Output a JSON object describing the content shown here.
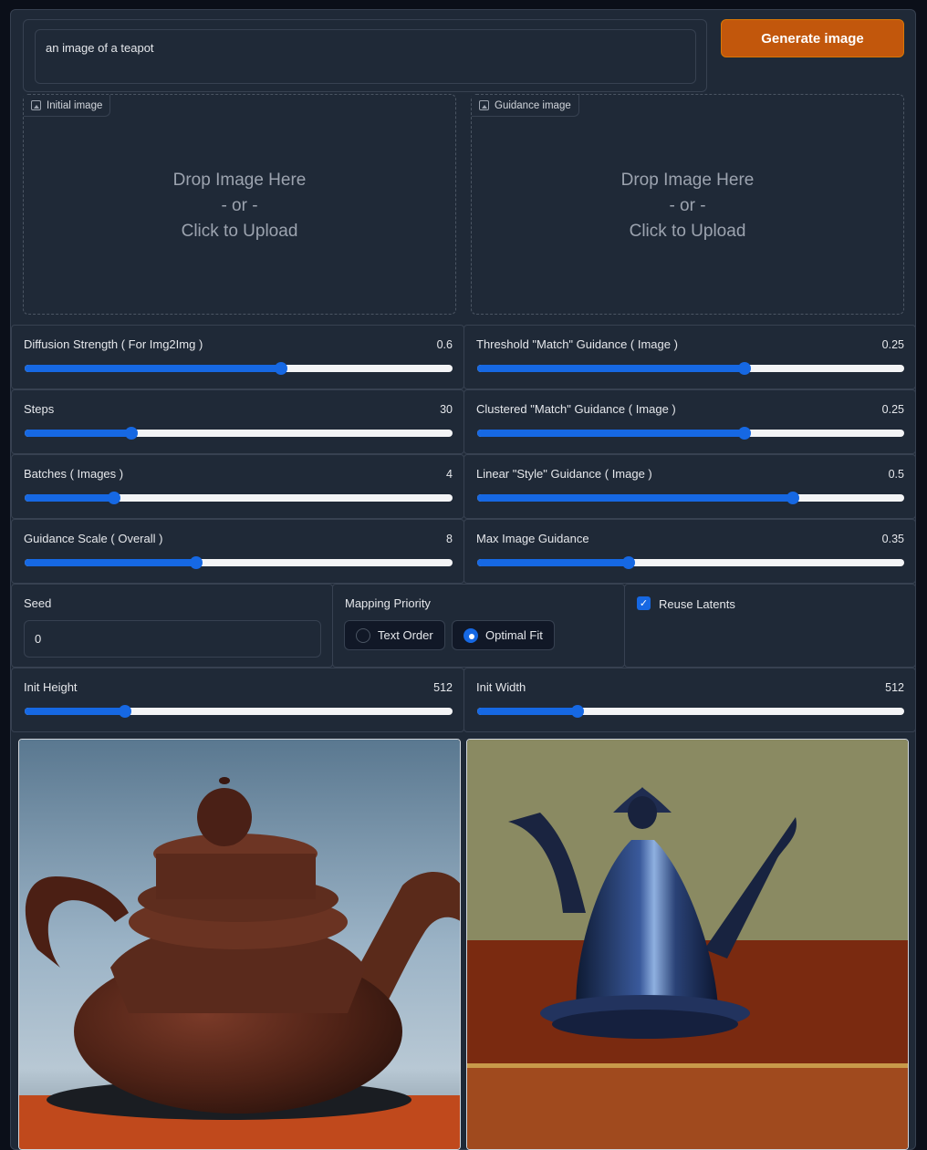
{
  "prompt": {
    "value": "an image of a teapot"
  },
  "generate_button": {
    "label": "Generate image"
  },
  "uploads": [
    {
      "tag": "Initial image",
      "line1": "Drop Image Here",
      "line2": "- or -",
      "line3": "Click to Upload"
    },
    {
      "tag": "Guidance image",
      "line1": "Drop Image Here",
      "line2": "- or -",
      "line3": "Click to Upload"
    }
  ],
  "sliders": {
    "diffusion_strength": {
      "label": "Diffusion Strength ( For Img2Img )",
      "value": "0.6",
      "fraction": 0.6
    },
    "threshold_match": {
      "label": "Threshold \"Match\" Guidance ( Image )",
      "value": "0.25",
      "fraction": 0.625
    },
    "steps": {
      "label": "Steps",
      "value": "30",
      "fraction": 0.25
    },
    "clustered_match": {
      "label": "Clustered \"Match\" Guidance ( Image )",
      "value": "0.25",
      "fraction": 0.625
    },
    "batches": {
      "label": "Batches ( Images )",
      "value": "4",
      "fraction": 0.21
    },
    "linear_style": {
      "label": "Linear \"Style\" Guidance ( Image )",
      "value": "0.5",
      "fraction": 0.74
    },
    "guidance_scale": {
      "label": "Guidance Scale ( Overall )",
      "value": "8",
      "fraction": 0.4
    },
    "max_image_guidance": {
      "label": "Max Image Guidance",
      "value": "0.35",
      "fraction": 0.355
    },
    "init_height": {
      "label": "Init Height",
      "value": "512",
      "fraction": 0.235
    },
    "init_width": {
      "label": "Init Width",
      "value": "512",
      "fraction": 0.235
    }
  },
  "seed": {
    "label": "Seed",
    "value": "0"
  },
  "mapping_priority": {
    "label": "Mapping Priority",
    "options": [
      "Text Order",
      "Optimal Fit"
    ],
    "selected": "Optimal Fit"
  },
  "reuse_latents": {
    "label": "Reuse Latents",
    "checked": true
  },
  "colors": {
    "accent": "#1668e3",
    "button": "#c2570c",
    "panel": "#1f2937"
  }
}
